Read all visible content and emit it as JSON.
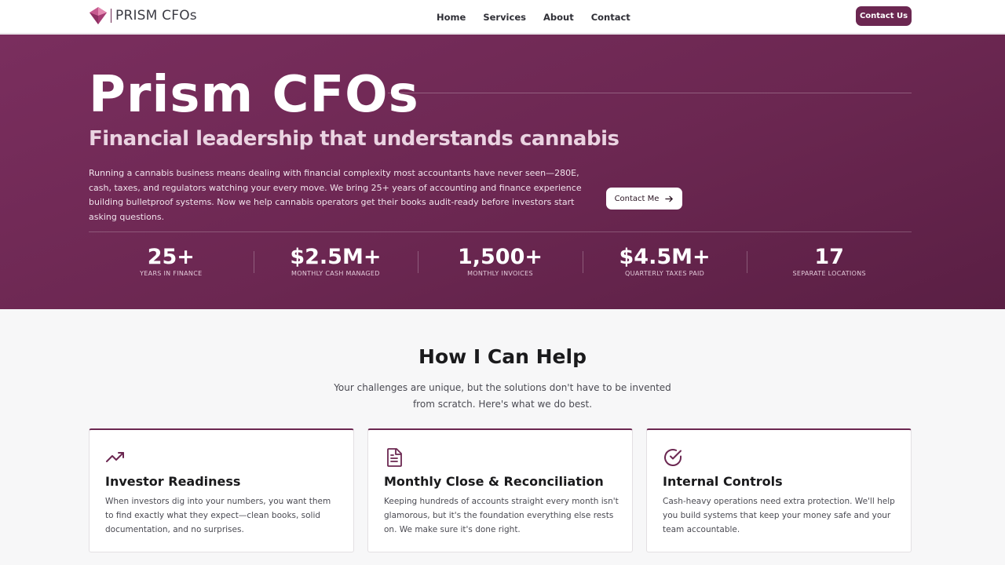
{
  "nav": {
    "logo_text": "PRISM CFOs",
    "links": [
      "Home",
      "Services",
      "About",
      "Contact"
    ],
    "cta": "Contact Us"
  },
  "hero": {
    "title": "Prism CFOs",
    "subtitle": "Financial leadership that understands cannabis",
    "body": "Running a cannabis business means dealing with financial complexity most accountants have never seen—280E, cash, taxes, and regulators watching your every move. We bring 25+ years of accounting and finance experience building bulletproof systems. Now we help cannabis operators get their books audit-ready before investors start asking questions.",
    "button": "Contact Me",
    "stats": [
      {
        "value": "25+",
        "label": "YEARS IN FINANCE"
      },
      {
        "value": "$2.5M+",
        "label": "MONTHLY CASH MANAGED"
      },
      {
        "value": "1,500+",
        "label": "MONTHLY INVOICES"
      },
      {
        "value": "$4.5M+",
        "label": "QUARTERLY TAXES PAID"
      },
      {
        "value": "17",
        "label": "SEPARATE LOCATIONS"
      }
    ]
  },
  "help": {
    "title": "How I Can Help",
    "description": "Your challenges are unique, but the solutions don't have to be invented from scratch. Here's what we do best.",
    "cards": [
      {
        "icon": "trending-up-icon",
        "title": "Investor Readiness",
        "body": "When investors dig into your numbers, you want them to find exactly what they expect—clean books, solid documentation, and no surprises."
      },
      {
        "icon": "document-icon",
        "title": "Monthly Close & Reconciliation",
        "body": "Keeping hundreds of accounts straight every month isn't glamorous, but it's the foundation everything else rests on. We make sure it's done right."
      },
      {
        "icon": "check-circle-icon",
        "title": "Internal Controls",
        "body": "Cash-heavy operations need extra protection. We'll help you build systems that keep your money safe and your team accountable."
      }
    ]
  },
  "colors": {
    "brand": "#6b2751",
    "hero_bg": "#6b2751",
    "white": "#ffffff"
  }
}
